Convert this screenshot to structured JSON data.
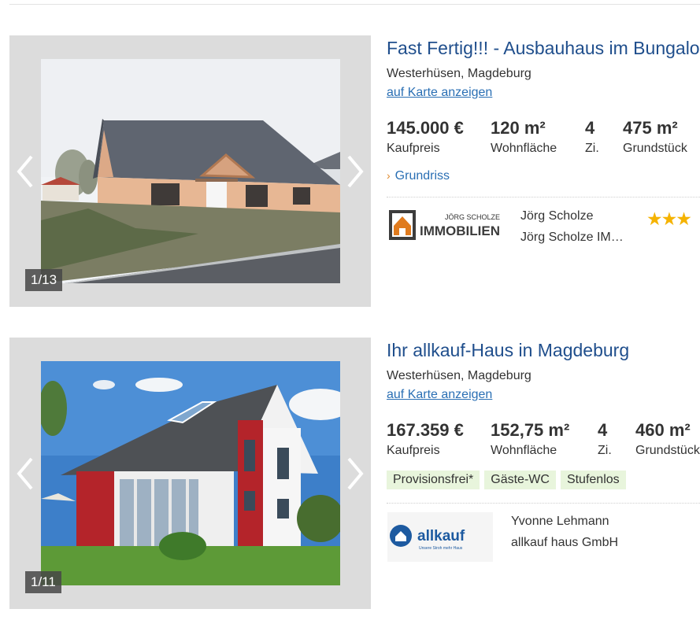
{
  "listings": [
    {
      "title": "Fast Fertig!!! - Ausbauhaus im Bungalo",
      "location": "Westerhüsen, Magdeburg",
      "map_link": "auf Karte anzeigen",
      "price": {
        "value": "145.000 €",
        "label": "Kaufpreis"
      },
      "living_area": {
        "value": "120 m²",
        "label": "Wohnfläche"
      },
      "rooms": {
        "value": "4",
        "label": "Zi."
      },
      "plot": {
        "value": "475 m²",
        "label": "Grundstück"
      },
      "floorplan_link": "Grundriss",
      "image_counter": "1/13",
      "agent_name": "Jörg Scholze",
      "agent_company": "Jörg Scholze IM…",
      "logo_top": "JÖRG SCHOLZE",
      "logo_bottom": "IMMOBILIEN",
      "rating_stars": 3,
      "stars_glyph": "★★★"
    },
    {
      "title": "Ihr allkauf-Haus in Magdeburg",
      "location": "Westerhüsen, Magdeburg",
      "map_link": "auf Karte anzeigen",
      "price": {
        "value": "167.359 €",
        "label": "Kaufpreis"
      },
      "living_area": {
        "value": "152,75 m²",
        "label": "Wohnfläche"
      },
      "rooms": {
        "value": "4",
        "label": "Zi."
      },
      "plot": {
        "value": "460 m²",
        "label": "Grundstück"
      },
      "tags": [
        "Provisionsfrei*",
        "Gäste-WC",
        "Stufenlos"
      ],
      "image_counter": "1/11",
      "agent_name": "Yvonne Lehmann",
      "agent_company": "allkauf haus GmbH",
      "logo_text": "allkauf",
      "logo_tagline": "Unsere Stroh mehr Haus"
    }
  ],
  "colors": {
    "title": "#1f4e8c",
    "link": "#2a6fb4",
    "tag_bg": "#e8f5dc",
    "star": "#f5b301",
    "gallery_bg": "#dcdcdc"
  }
}
